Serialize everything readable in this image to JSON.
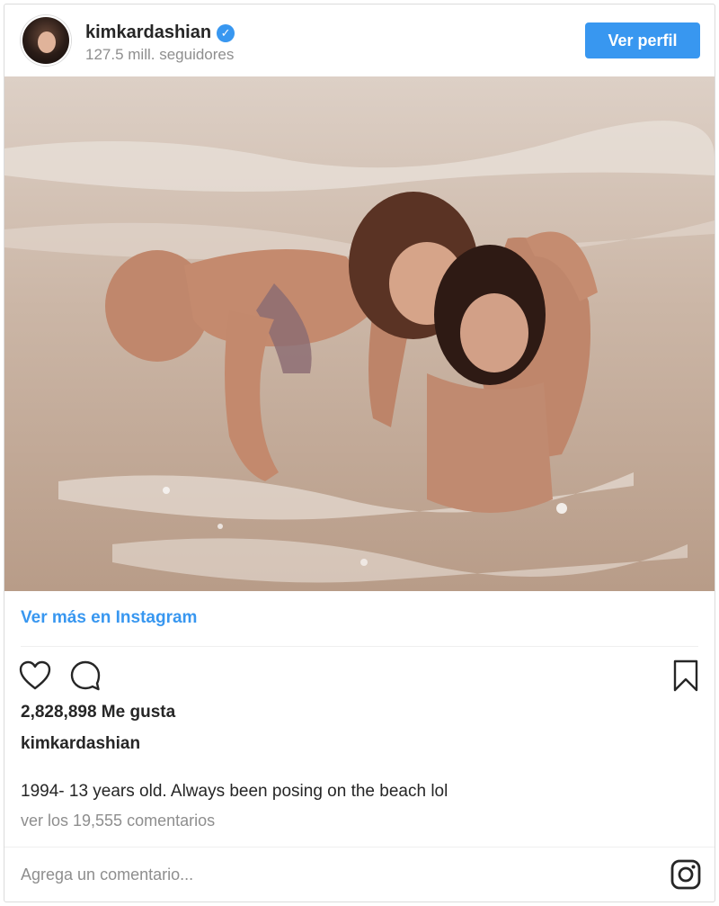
{
  "header": {
    "username": "kimkardashian",
    "verified_mark": "✓",
    "followers": "127.5 mill. seguidores",
    "profile_button": "Ver perfil"
  },
  "post": {
    "image_alt": "Beach photo",
    "more_link": "Ver más en Instagram",
    "likes": "2,828,898 Me gusta",
    "caption_username": "kimkardashian",
    "caption": "1994- 13 years old. Always been posing on the beach lol",
    "comments_link": "ver los 19,555 comentarios",
    "comment_placeholder": "Agrega un comentario..."
  },
  "icons": {
    "like": "heart-icon",
    "comment": "comment-icon",
    "save": "bookmark-icon",
    "brand": "instagram-icon"
  },
  "colors": {
    "accent": "#3897f0",
    "text": "#262626",
    "muted": "#8e8e8e",
    "border": "#dbdbdb"
  }
}
